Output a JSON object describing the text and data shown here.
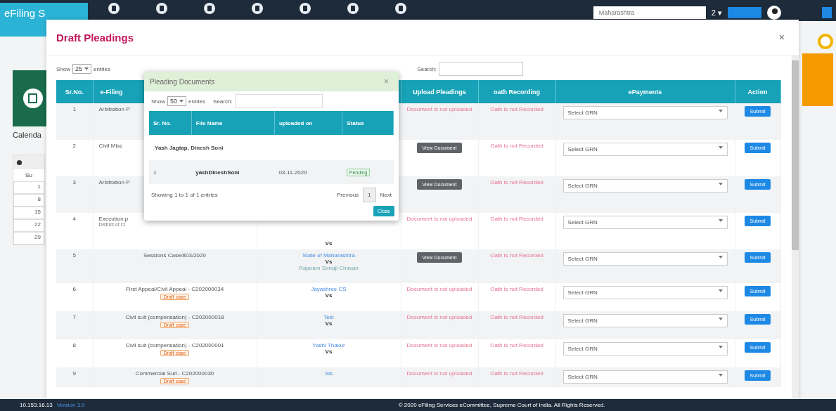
{
  "navbar": {
    "brand": "eFiling S",
    "state_select": "Maharashtra",
    "count": "2 ▾"
  },
  "sidebar": {
    "heading": "Calenda",
    "day_header": "Su",
    "days": [
      "1",
      "8",
      "15",
      "22",
      "29"
    ]
  },
  "modal": {
    "title": "Draft Pleadings",
    "close": "×",
    "show_label": "Show",
    "show_value": "25",
    "entries_label": "entries",
    "search_label": "Search:",
    "columns": [
      {
        "label": "Sr.No."
      },
      {
        "label": "e-Filing"
      },
      {},
      {
        "label": "Upload Pleadings"
      },
      {
        "label": "oath Recording"
      },
      {
        "label": "ePayments"
      },
      {
        "label": "Action"
      }
    ],
    "rows": [
      {
        "sr": "1",
        "efiling": "Arbitration P",
        "covered": true,
        "note": "",
        "badge": "",
        "petitioner": "",
        "vs": "",
        "respondent": "",
        "upload": {
          "kind": "text",
          "text": "Document is not uploaded"
        },
        "oath": "Oath is not Recorded",
        "payment": "Select GRN",
        "action": "Submit"
      },
      {
        "sr": "2",
        "efiling": "Civil Misc",
        "covered": true,
        "note": "",
        "badge": "",
        "petitioner": "",
        "vs": "",
        "respondent": "",
        "upload": {
          "kind": "button",
          "text": "View Document"
        },
        "oath": "Oath is not Recorded",
        "payment": "Select GRN",
        "action": "Submit"
      },
      {
        "sr": "3",
        "efiling": "Arbitration P",
        "covered": true,
        "note": "",
        "badge": "",
        "petitioner": "",
        "vs": "",
        "respondent": "",
        "upload": {
          "kind": "button",
          "text": "View Document"
        },
        "oath": "Oath is not Recorded",
        "payment": "Select GRN",
        "action": "Submit"
      },
      {
        "sr": "4",
        "efiling": "Execution p",
        "covered": true,
        "note": "District of Ci",
        "badge": "",
        "petitioner": "",
        "vs": "Vs",
        "respondent": "",
        "upload": {
          "kind": "text",
          "text": "Document is not uploaded"
        },
        "oath": "Oath is not Recorded",
        "payment": "Select GRN",
        "action": "Submit"
      },
      {
        "sr": "5",
        "efiling": "Sessions Case/803/2020",
        "covered": false,
        "note": "",
        "badge": "",
        "petitioner": "State of Maharashtra",
        "vs": "Vs",
        "respondent": "Rajaram Sonaji Chavan",
        "upload": {
          "kind": "button",
          "text": "View Document"
        },
        "oath": "Oath is not Recorded",
        "payment": "Select GRN",
        "action": "Submit"
      },
      {
        "sr": "6",
        "efiling": "First Appeal/Civil Appeal - C202000034",
        "covered": false,
        "note": "",
        "badge": "Draft case",
        "petitioner": "Jayashree CS",
        "vs": "Vs",
        "respondent": "",
        "upload": {
          "kind": "text",
          "text": "Document is not uploaded"
        },
        "oath": "Oath is not Recorded",
        "payment": "Select GRN",
        "action": "Submit"
      },
      {
        "sr": "7",
        "efiling": "Civil suit (compensation) - C202000018",
        "covered": false,
        "note": "",
        "badge": "Draft case",
        "petitioner": "Test",
        "vs": "Vs",
        "respondent": "",
        "upload": {
          "kind": "text",
          "text": "Document is not uploaded"
        },
        "oath": "Oath is not Recorded",
        "payment": "Select GRN",
        "action": "Submit"
      },
      {
        "sr": "8",
        "efiling": "Civil suit (compensation) - C202000001",
        "covered": false,
        "note": "",
        "badge": "Draft case",
        "petitioner": "Yashi Thakur",
        "vs": "Vs",
        "respondent": "",
        "upload": {
          "kind": "text",
          "text": "Document is not uploaded"
        },
        "oath": "Oath is not Recorded",
        "payment": "Select GRN",
        "action": "Submit"
      },
      {
        "sr": "9",
        "efiling": "Commercial Suit - C202000030",
        "covered": false,
        "note": "",
        "badge": "Draft case",
        "petitioner": "Sis",
        "vs": "",
        "respondent": "",
        "upload": {
          "kind": "text",
          "text": "Document is not uploaded"
        },
        "oath": "Oath is not Recorded",
        "payment": "Select GRN",
        "action": "Submit"
      }
    ]
  },
  "popup": {
    "title": "Pleading Documents",
    "close": "×",
    "show_label": "Show",
    "show_value": "50",
    "entries_label": "entries",
    "search_label": "Search:",
    "columns": [
      "Sr. No.",
      "File Name",
      "uploaded on",
      "Status"
    ],
    "group": "Yash Jagtap, Dinesh Soni",
    "rows": [
      {
        "sr": "1",
        "file": "yashDineshSoni",
        "uploaded": "03-11-2020",
        "status": "Pending"
      }
    ],
    "info": "Showing 1 to 1 of 1 entries",
    "previous": "Previous",
    "page": "1",
    "next": "Next",
    "button": "Close"
  },
  "footer": {
    "ip": "10.153.16.13",
    "version": "Version 3.0",
    "copyright": "© 2020 eFiling Services eCommittee, Supreme Court of India. All Rights Reserved."
  }
}
